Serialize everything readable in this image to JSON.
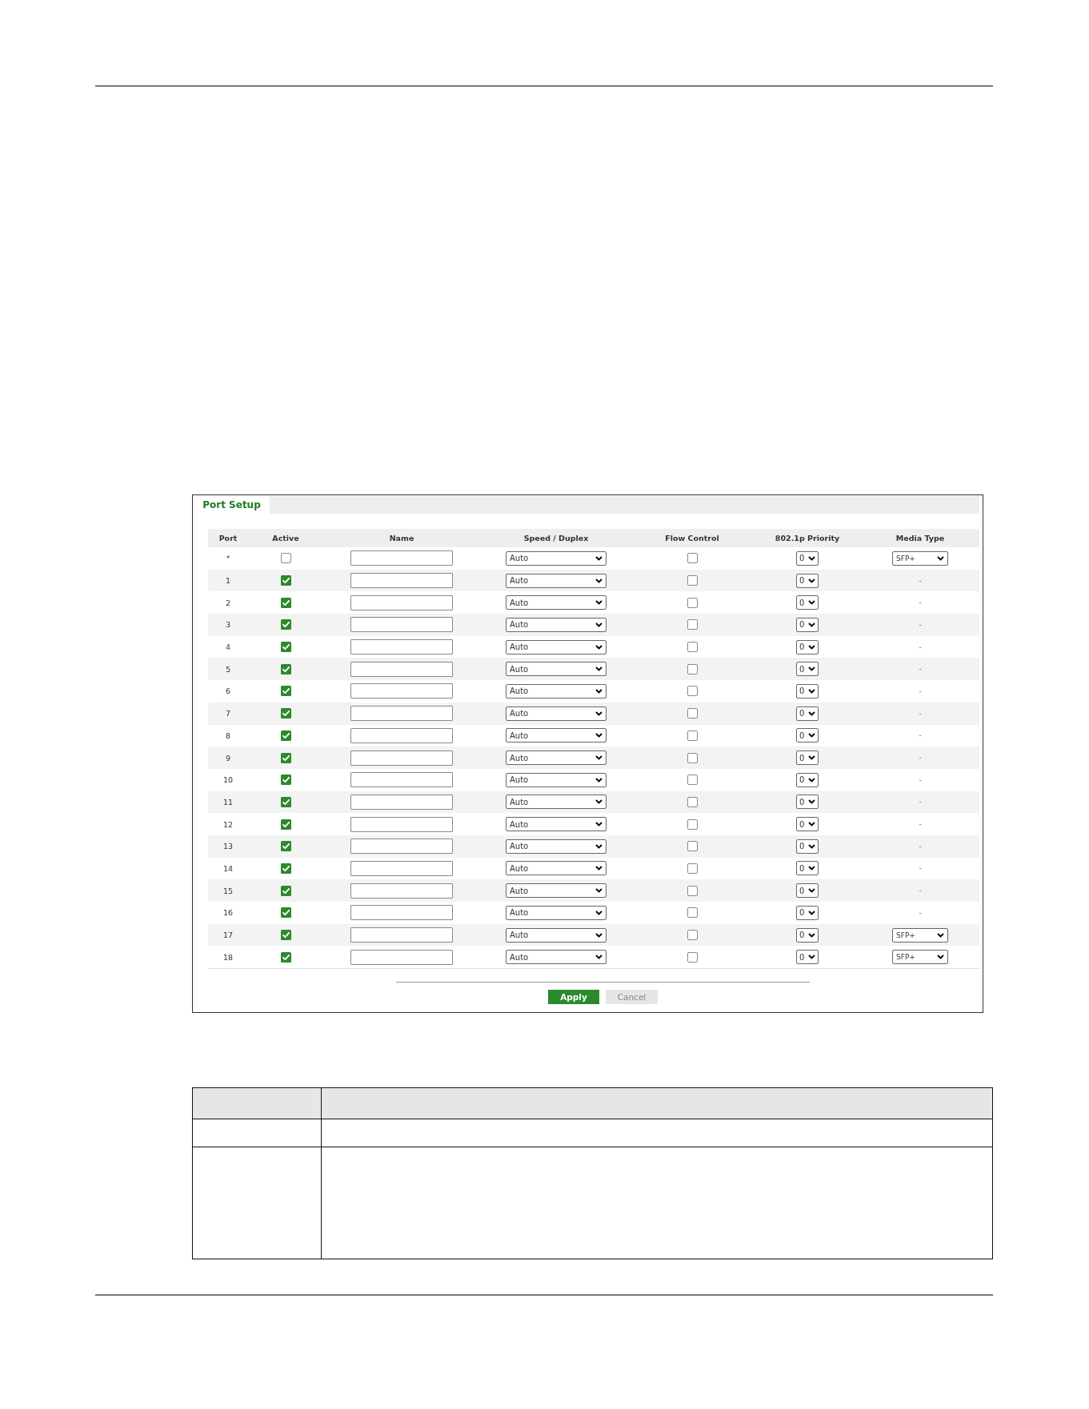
{
  "panel": {
    "tab": {
      "label": "Port Setup",
      "selected": true
    }
  },
  "table": {
    "columns": [
      "Port",
      "Active",
      "Name",
      "Speed / Duplex",
      "Flow Control",
      "802.1p Priority",
      "Media Type"
    ],
    "rows": [
      {
        "port": "*",
        "active": false,
        "speed": "Auto",
        "flow_control": false,
        "priority": "0",
        "media": {
          "kind": "select",
          "value": "SFP+"
        }
      },
      {
        "port": "1",
        "active": true,
        "speed": "Auto",
        "flow_control": false,
        "priority": "0",
        "media": {
          "kind": "text",
          "value": "-"
        }
      },
      {
        "port": "2",
        "active": true,
        "speed": "Auto",
        "flow_control": false,
        "priority": "0",
        "media": {
          "kind": "text",
          "value": "-"
        }
      },
      {
        "port": "3",
        "active": true,
        "speed": "Auto",
        "flow_control": false,
        "priority": "0",
        "media": {
          "kind": "text",
          "value": "-"
        }
      },
      {
        "port": "4",
        "active": true,
        "speed": "Auto",
        "flow_control": false,
        "priority": "0",
        "media": {
          "kind": "text",
          "value": "-"
        }
      },
      {
        "port": "5",
        "active": true,
        "speed": "Auto",
        "flow_control": false,
        "priority": "0",
        "media": {
          "kind": "text",
          "value": "-"
        }
      },
      {
        "port": "6",
        "active": true,
        "speed": "Auto",
        "flow_control": false,
        "priority": "0",
        "media": {
          "kind": "text",
          "value": "-"
        }
      },
      {
        "port": "7",
        "active": true,
        "speed": "Auto",
        "flow_control": false,
        "priority": "0",
        "media": {
          "kind": "text",
          "value": "-"
        }
      },
      {
        "port": "8",
        "active": true,
        "speed": "Auto",
        "flow_control": false,
        "priority": "0",
        "media": {
          "kind": "text",
          "value": "-"
        }
      },
      {
        "port": "9",
        "active": true,
        "speed": "Auto",
        "flow_control": false,
        "priority": "0",
        "media": {
          "kind": "text",
          "value": "-"
        }
      },
      {
        "port": "10",
        "active": true,
        "speed": "Auto",
        "flow_control": false,
        "priority": "0",
        "media": {
          "kind": "text",
          "value": "-"
        }
      },
      {
        "port": "11",
        "active": true,
        "speed": "Auto",
        "flow_control": false,
        "priority": "0",
        "media": {
          "kind": "text",
          "value": "-"
        }
      },
      {
        "port": "12",
        "active": true,
        "speed": "Auto",
        "flow_control": false,
        "priority": "0",
        "media": {
          "kind": "text",
          "value": "-"
        }
      },
      {
        "port": "13",
        "active": true,
        "speed": "Auto",
        "flow_control": false,
        "priority": "0",
        "media": {
          "kind": "text",
          "value": "-"
        }
      },
      {
        "port": "14",
        "active": true,
        "speed": "Auto",
        "flow_control": false,
        "priority": "0",
        "media": {
          "kind": "text",
          "value": "-"
        }
      },
      {
        "port": "15",
        "active": true,
        "speed": "Auto",
        "flow_control": false,
        "priority": "0",
        "media": {
          "kind": "text",
          "value": "-"
        }
      },
      {
        "port": "16",
        "active": true,
        "speed": "Auto",
        "flow_control": false,
        "priority": "0",
        "media": {
          "kind": "text",
          "value": "-"
        }
      },
      {
        "port": "17",
        "active": true,
        "speed": "Auto",
        "flow_control": false,
        "priority": "0",
        "media": {
          "kind": "select",
          "value": "SFP+"
        }
      },
      {
        "port": "18",
        "active": true,
        "speed": "Auto",
        "flow_control": false,
        "priority": "0",
        "media": {
          "kind": "select",
          "value": "SFP+"
        }
      }
    ]
  },
  "buttons": [
    {
      "label": "Apply",
      "kind": "primary"
    },
    {
      "label": "Cancel",
      "kind": "secondary"
    }
  ]
}
